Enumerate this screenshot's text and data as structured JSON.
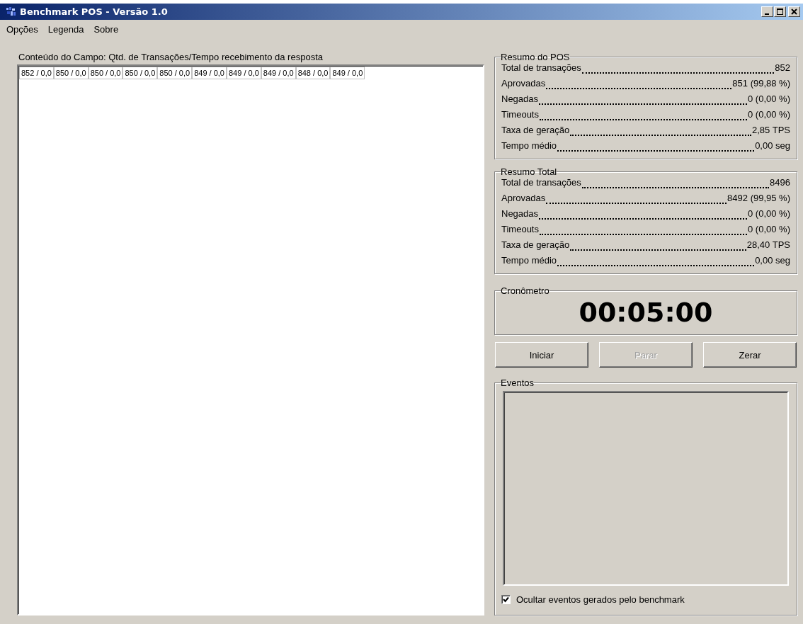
{
  "window": {
    "title": "Benchmark POS - Versão 1.0"
  },
  "menu": [
    {
      "label": "Opções"
    },
    {
      "label": "Legenda"
    },
    {
      "label": "Sobre"
    }
  ],
  "field_content": {
    "label": "Conteúdo do Campo: Qtd. de Transações/Tempo recebimento da resposta",
    "cells": [
      "852 / 0,0",
      "850 / 0,0",
      "850 / 0,0",
      "850 / 0,0",
      "850 / 0,0",
      "849 / 0,0",
      "849 / 0,0",
      "849 / 0,0",
      "848 / 0,0",
      "849 / 0,0"
    ]
  },
  "summaries": [
    {
      "title": "Resumo do POS",
      "rows": [
        {
          "label": "Total de transações",
          "value": "852"
        },
        {
          "label": "Aprovadas",
          "value": "851 (99,88 %)"
        },
        {
          "label": "Negadas",
          "value": "0 (0,00 %)"
        },
        {
          "label": "Timeouts",
          "value": "0 (0,00 %)"
        },
        {
          "label": "Taxa de geração",
          "value": "2,85 TPS"
        },
        {
          "label": "Tempo médio",
          "value": "0,00 seg"
        }
      ]
    },
    {
      "title": "Resumo Total",
      "rows": [
        {
          "label": "Total de transações",
          "value": "8496"
        },
        {
          "label": "Aprovadas",
          "value": "8492 (99,95 %)"
        },
        {
          "label": "Negadas",
          "value": "0 (0,00 %)"
        },
        {
          "label": "Timeouts",
          "value": "0 (0,00 %)"
        },
        {
          "label": "Taxa de geração",
          "value": "28,40 TPS"
        },
        {
          "label": "Tempo médio",
          "value": "0,00 seg"
        }
      ]
    }
  ],
  "stopwatch": {
    "title": "Cronômetro",
    "time": "00:05:00"
  },
  "buttons": [
    {
      "label": "Iniciar",
      "disabled": false
    },
    {
      "label": "Parar",
      "disabled": true
    },
    {
      "label": "Zerar",
      "disabled": false
    }
  ],
  "events": {
    "title": "Eventos",
    "hide_benchmark_events": {
      "label": "Ocultar eventos gerados pelo benchmark",
      "checked": true
    }
  }
}
